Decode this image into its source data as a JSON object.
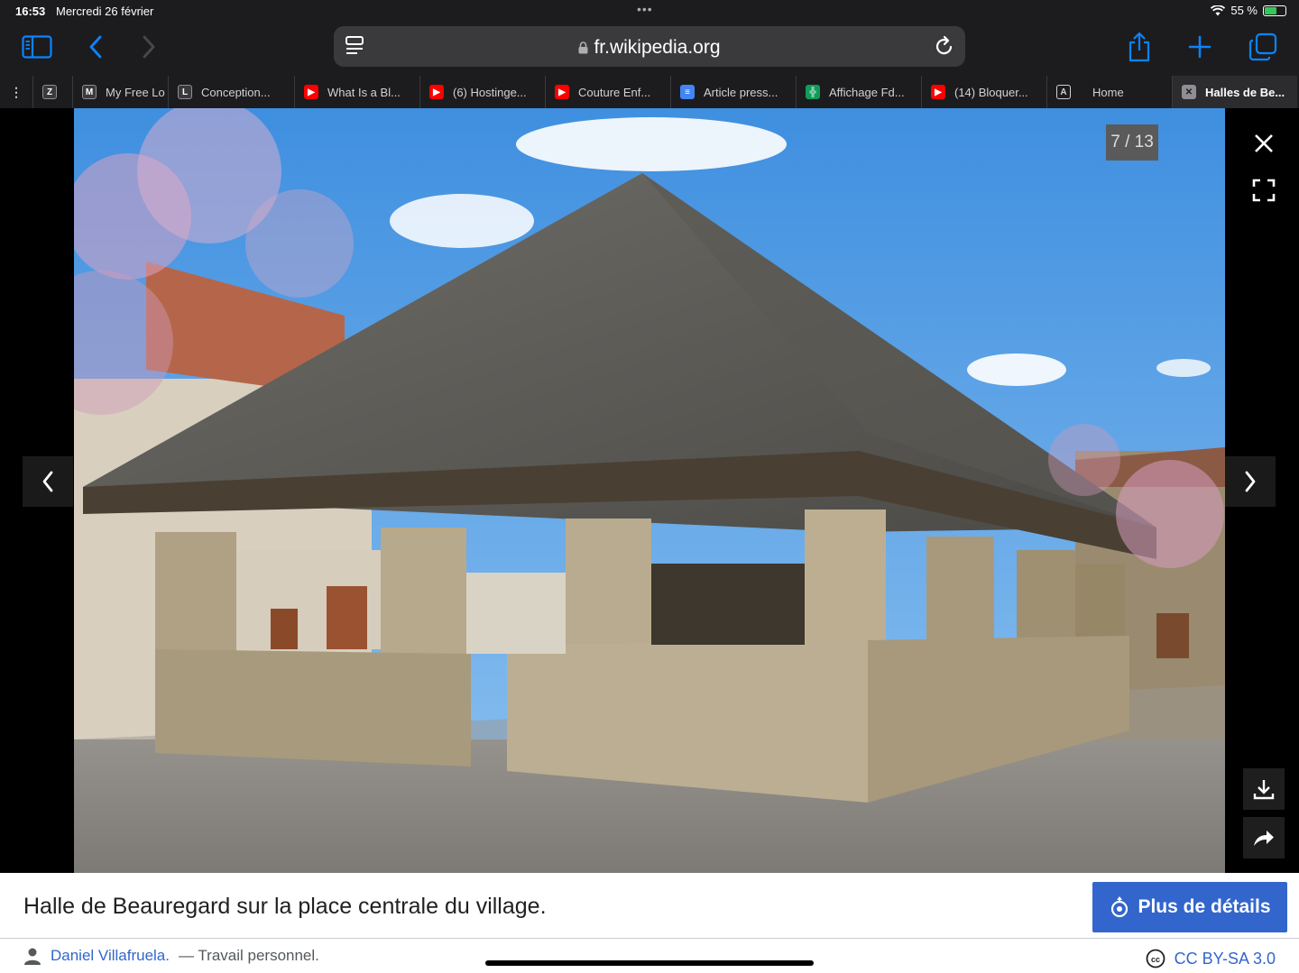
{
  "status": {
    "time": "16:53",
    "date": "Mercredi 26 février",
    "battery": "55 %",
    "battery_level": 0.55
  },
  "browser": {
    "url": "fr.wikipedia.org"
  },
  "tabs": [
    {
      "label": "Z",
      "icon": "Z",
      "color": "#3a3a3c"
    },
    {
      "label": "My Free Lo",
      "icon": "M",
      "color": "#3a3a3c"
    },
    {
      "label": "Conception...",
      "icon": "L",
      "color": "#3a3a3c"
    },
    {
      "label": "What Is a Bl...",
      "icon": "youtube-icon",
      "color": "#ff0000"
    },
    {
      "label": "(6) Hostinge...",
      "icon": "youtube-icon",
      "color": "#ff0000"
    },
    {
      "label": "Couture Enf...",
      "icon": "youtube-icon",
      "color": "#ff0000"
    },
    {
      "label": "Article press...",
      "icon": "docs-icon",
      "color": "#4285f4"
    },
    {
      "label": "Affichage Fd...",
      "icon": "sheets-icon",
      "color": "#0f9d58"
    },
    {
      "label": "(14) Bloquer...",
      "icon": "youtube-icon",
      "color": "#ff0000"
    },
    {
      "label": "Home",
      "icon": "A",
      "color": "#3a3a3c"
    },
    {
      "label": "Halles de Be...",
      "icon": "close-icon",
      "color": "#3a3a3c"
    }
  ],
  "viewer": {
    "counter": "7 / 13"
  },
  "caption": {
    "text": "Halle de Beauregard sur la place centrale du village.",
    "details_label": "Plus de détails",
    "author": "Daniel Villafruela.",
    "author_note": "— Travail personnel.",
    "license": "CC BY-SA 3.0"
  },
  "colors": {
    "accent": "#3366cc",
    "chrome": "#1c1c1e"
  }
}
